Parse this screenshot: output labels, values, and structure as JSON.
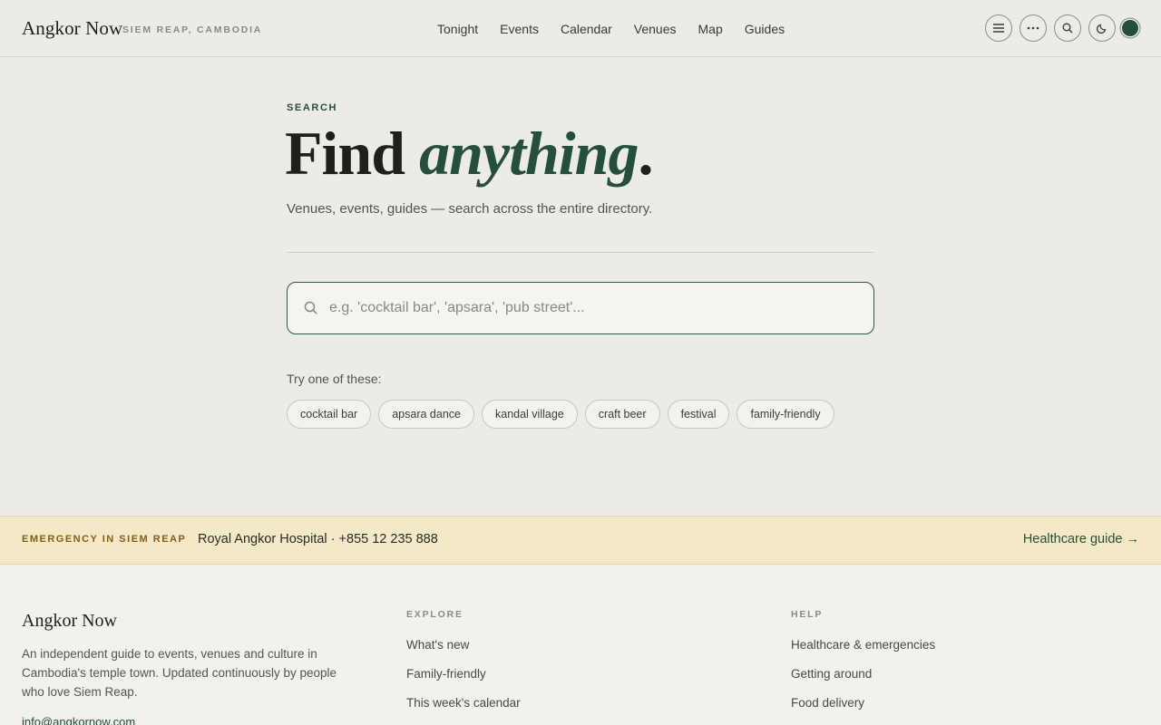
{
  "header": {
    "logo": "Angkor Now",
    "logo_sub": "SIEM REAP, CAMBODIA",
    "nav": [
      "Tonight",
      "Events",
      "Calendar",
      "Venues",
      "Map",
      "Guides"
    ],
    "icons": [
      "menu-icon",
      "more-icon",
      "search-icon",
      "moon-icon",
      "theme-dot"
    ]
  },
  "main": {
    "eyebrow": "SEARCH",
    "title_plain": "Find ",
    "title_accent": "anything",
    "title_end": ".",
    "subtitle": "Venues, events, guides — search across the entire directory.",
    "search": {
      "placeholder": "e.g. 'cocktail bar', 'apsara', 'pub street'...",
      "value": ""
    },
    "try_label": "Try one of these:",
    "suggestions": [
      "cocktail bar",
      "apsara dance",
      "kandal village",
      "craft beer",
      "festival",
      "family-friendly"
    ]
  },
  "emergency": {
    "label": "EMERGENCY IN SIEM REAP",
    "text": "Royal Angkor Hospital · +855 12 235 888",
    "link": "Healthcare guide →"
  },
  "footer": {
    "logo": "Angkor Now",
    "description": "An independent guide to events, venues and culture in Cambodia's temple town. Updated continuously by people who love Siem Reap.",
    "email": "info@angkornow.com",
    "explore": {
      "heading": "EXPLORE",
      "links": [
        "What's new",
        "Family-friendly",
        "This week's calendar"
      ]
    },
    "help": {
      "heading": "HELP",
      "links": [
        "Healthcare & emergencies",
        "Getting around",
        "Food delivery"
      ]
    }
  },
  "colors": {
    "accent": "#24503b",
    "background": "#ecebe5",
    "emergency_bg": "#f4e9c6",
    "emergency_label": "#8a5a12"
  }
}
